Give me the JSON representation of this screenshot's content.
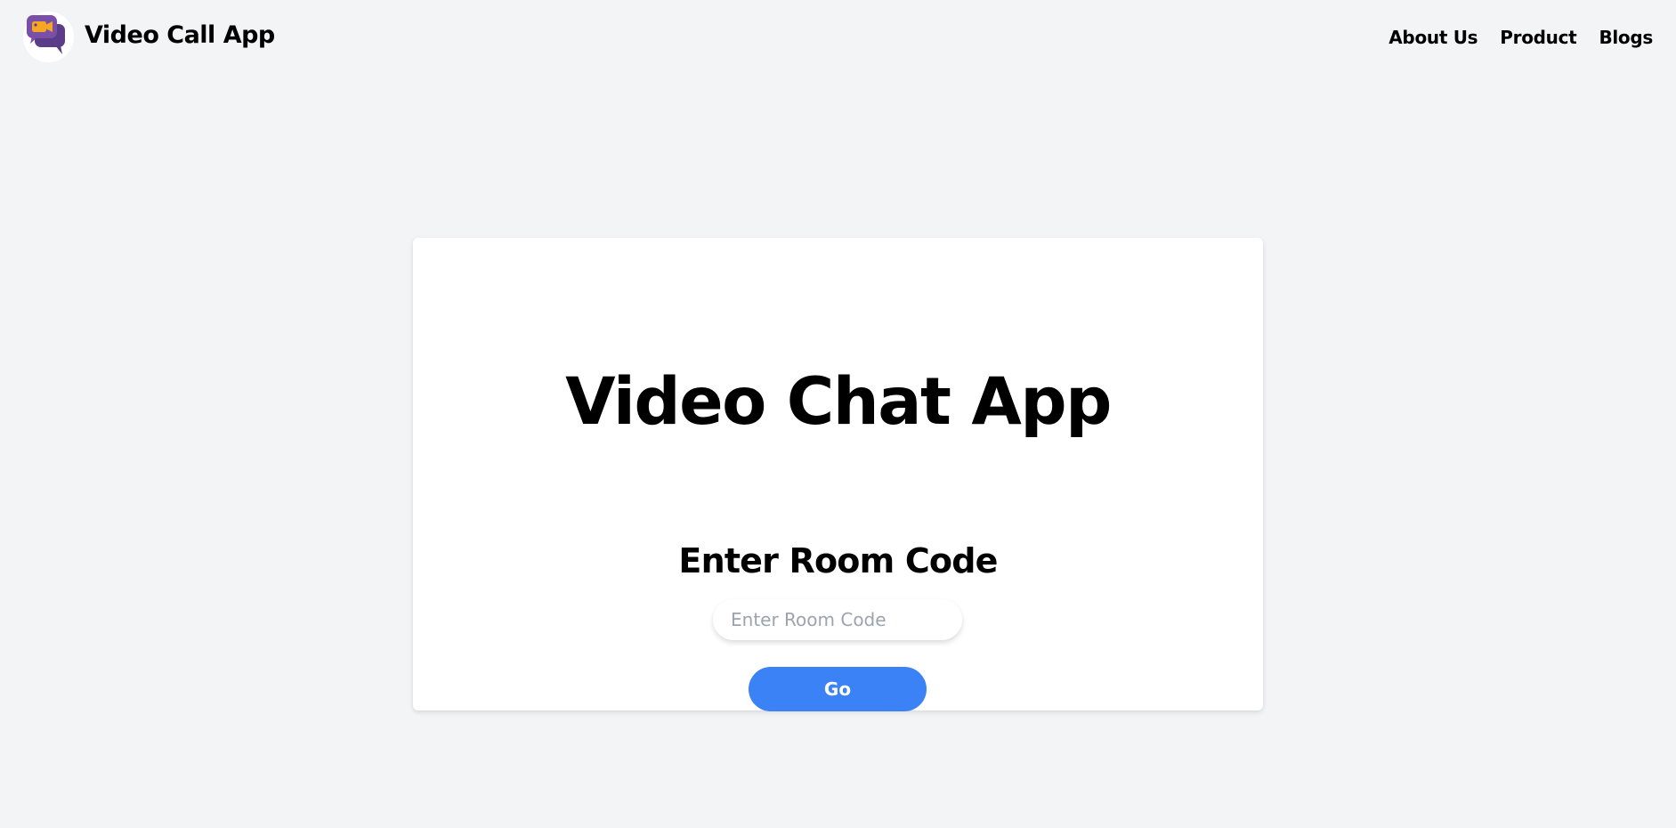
{
  "header": {
    "app_title": "Video Call App",
    "logo_icon": "video-chat-bubbles-icon",
    "nav": [
      {
        "label": "About Us"
      },
      {
        "label": "Product"
      },
      {
        "label": "Blogs"
      }
    ]
  },
  "main": {
    "title": "Video Chat App",
    "subtitle": "Enter Room Code",
    "room_input": {
      "placeholder": "Enter Room Code",
      "value": ""
    },
    "go_label": "Go"
  },
  "colors": {
    "background": "#f3f4f6",
    "card": "#ffffff",
    "accent": "#3b82f6",
    "logo_purple": "#5b3c88",
    "logo_purple_light": "#7a4fa8",
    "logo_camera": "#f5a623"
  }
}
